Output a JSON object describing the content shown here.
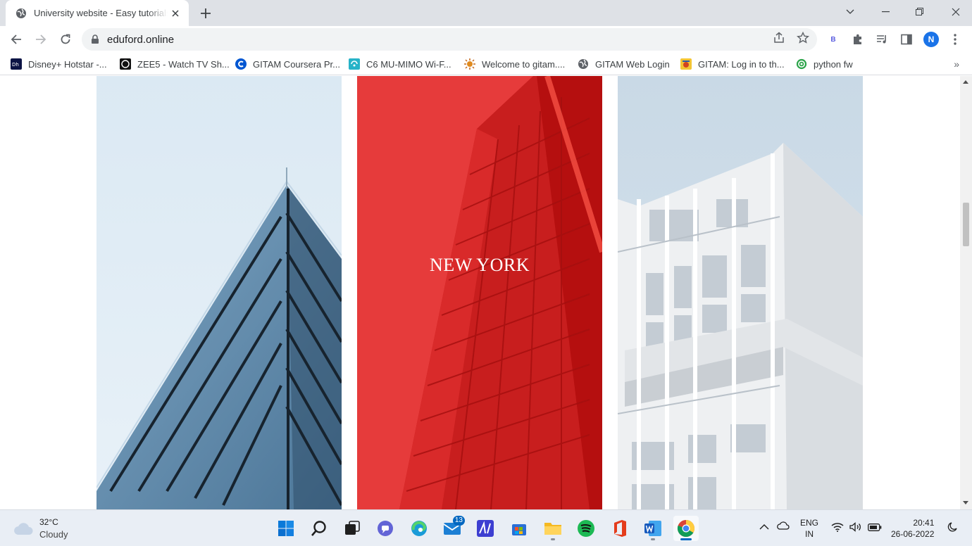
{
  "browser": {
    "tab": {
      "title": "University website - Easy tutorials"
    },
    "address": {
      "url": "eduford.online"
    },
    "profile_initial": "N",
    "extension_label": "B",
    "bookmarks": [
      {
        "label": "Disney+ Hotstar -...",
        "icon": "hotstar-icon"
      },
      {
        "label": "ZEE5 - Watch TV Sh...",
        "icon": "zee5-icon"
      },
      {
        "label": "GITAM Coursera Pr...",
        "icon": "coursera-icon"
      },
      {
        "label": "C6 MU-MIMO Wi-F...",
        "icon": "router-icon"
      },
      {
        "label": "Welcome to gitam....",
        "icon": "gitam-sun-icon"
      },
      {
        "label": "GITAM Web Login",
        "icon": "globe-icon"
      },
      {
        "label": "GITAM: Log in to th...",
        "icon": "gitam-logo-icon"
      },
      {
        "label": "python fw",
        "icon": "python-fw-icon"
      }
    ],
    "bookmarks_overflow": "»"
  },
  "page": {
    "panels": [
      {
        "name": "glass-triangle-building",
        "title": ""
      },
      {
        "name": "red-tower",
        "title": "NEW YORK"
      },
      {
        "name": "white-building",
        "title": ""
      }
    ]
  },
  "taskbar": {
    "weather": {
      "temp": "32°C",
      "condition": "Cloudy"
    },
    "mail_badge": "13",
    "language": {
      "lang": "ENG",
      "region": "IN"
    },
    "clock": {
      "time": "20:41",
      "date": "26-06-2022"
    }
  },
  "colors": {
    "chrome_frame": "#dee1e6",
    "omnibox": "#f1f3f4",
    "red_overlay": "#e53935",
    "taskbar": "#e9eef5",
    "accent": "#0067c0"
  }
}
